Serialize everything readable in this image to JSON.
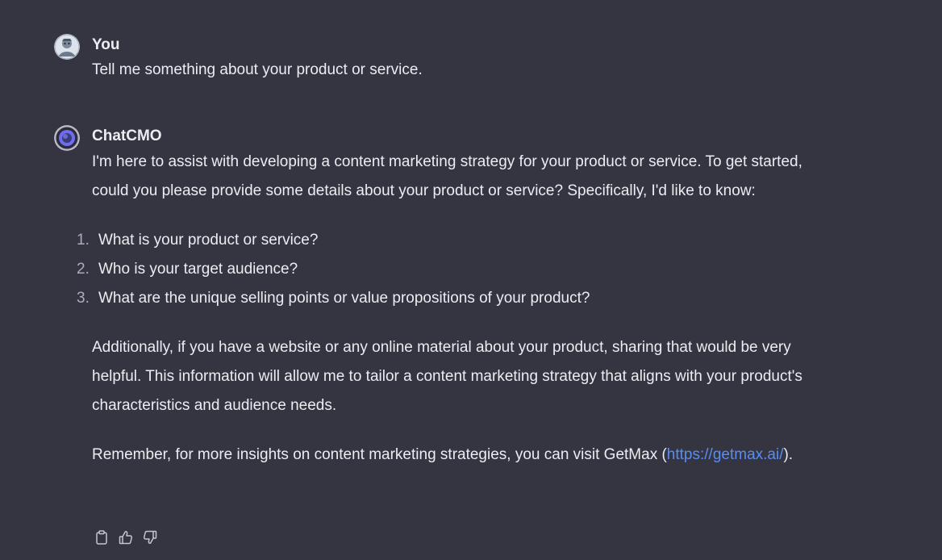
{
  "user_message": {
    "author": "You",
    "text": "Tell me something about your product or service."
  },
  "assistant_message": {
    "author": "ChatCMO",
    "intro": "I'm here to assist with developing a content marketing strategy for your product or service. To get started, could you please provide some details about your product or service? Specifically, I'd like to know:",
    "list": [
      {
        "number": "1.",
        "text": "What is your product or service?"
      },
      {
        "number": "2.",
        "text": "Who is your target audience?"
      },
      {
        "number": "3.",
        "text": "What are the unique selling points or value propositions of your product?"
      }
    ],
    "additional": "Additionally, if you have a website or any online material about your product, sharing that would be very helpful. This information will allow me to tailor a content marketing strategy that aligns with your product's characteristics and audience needs.",
    "reminder_prefix": "Remember, for more insights on content marketing strategies, you can visit GetMax (",
    "reminder_link": "https://getmax.ai/",
    "reminder_suffix": ")."
  },
  "actions": [
    {
      "name": "copy-icon"
    },
    {
      "name": "thumbs-up-icon"
    },
    {
      "name": "thumbs-down-icon"
    }
  ],
  "colors": {
    "background": "#343541",
    "text": "#ececf1",
    "link": "#5b8def",
    "bot_avatar_accent": "#6e6cf0"
  }
}
